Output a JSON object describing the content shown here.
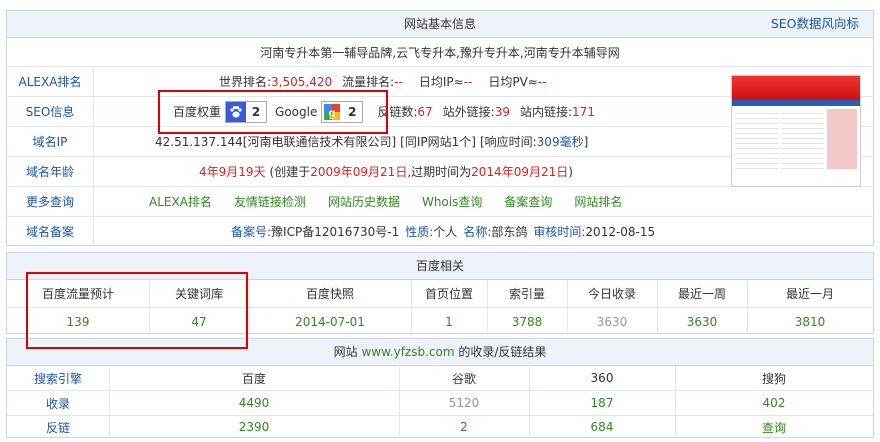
{
  "basic": {
    "header": "网站基本信息",
    "seo_link": "SEO数据风向标",
    "subtitle": "河南专升本第一辅导品牌,云飞专升本,豫升专升本,河南专升本辅导网",
    "alexa": {
      "label": "ALEXA排名",
      "world_rank_label": "世界排名:",
      "world_rank": "3,505,420",
      "traffic_rank_label": "流量排名:",
      "traffic_rank": "--",
      "daily_ip_label": "日均IP≈",
      "daily_ip": "--",
      "daily_pv_label": "日均PV≈",
      "daily_pv": "--"
    },
    "seo": {
      "label": "SEO信息",
      "baidu_weight_label": "百度权重",
      "baidu_weight": "2",
      "google_label": "Google",
      "google_pr": "2",
      "backlinks_label": "反链数:",
      "backlinks": "67",
      "external_links_label": "站外链接:",
      "external_links": "39",
      "internal_links_label": "站内链接:",
      "internal_links": "171"
    },
    "ip": {
      "label": "域名IP",
      "value": "42.51.137.144[河南电联通信技术有限公司]",
      "same_ip": "[同IP网站1个]",
      "response_label": "[响应时间:",
      "response_time": "309毫秒",
      "response_end": "]"
    },
    "age": {
      "label": "域名年龄",
      "age": "4年9月19天",
      "created_label": "(创建于",
      "created": "2009年09月21日",
      "expire_label": ",过期时间为",
      "expire": "2014年09月21日",
      "end": ")"
    },
    "more": {
      "label": "更多查询",
      "links": [
        "ALEXA排名",
        "友情链接检测",
        "网站历史数据",
        "Whois查询",
        "备案查询",
        "网站排名"
      ]
    },
    "icp": {
      "label": "域名备案",
      "icp_label": "备案号:",
      "icp_value": "豫ICP备12016730号-1",
      "nature_label": "性质:",
      "nature": "个人",
      "name_label": "名称:",
      "name": "部东鸽",
      "audit_label": "审核时间:",
      "audit": "2012-08-15"
    }
  },
  "baidu": {
    "header": "百度相关",
    "columns": [
      "百度流量预计",
      "关键词库",
      "百度快照",
      "首页位置",
      "索引量",
      "今日收录",
      "最近一周",
      "最近一月"
    ],
    "values": [
      "139",
      "47",
      "2014-07-01",
      "1",
      "3788",
      "3630",
      "3630",
      "3810"
    ]
  },
  "index": {
    "header_prefix": "网站",
    "domain": "www.yfzsb.com",
    "header_suffix": "的收录/反链结果",
    "columns": [
      "搜索引擎",
      "百度",
      "谷歌",
      "360",
      "搜狗"
    ],
    "rows": [
      {
        "label": "收录",
        "values": [
          "4490",
          "5120",
          "187",
          "402"
        ]
      },
      {
        "label": "反链",
        "values": [
          "2390",
          "2",
          "684",
          "查询"
        ]
      }
    ]
  },
  "colors": {
    "accent": "#1a56a8",
    "highlight": "#e00000",
    "value_green": "#2e8b1e",
    "value_red": "#e02020"
  }
}
